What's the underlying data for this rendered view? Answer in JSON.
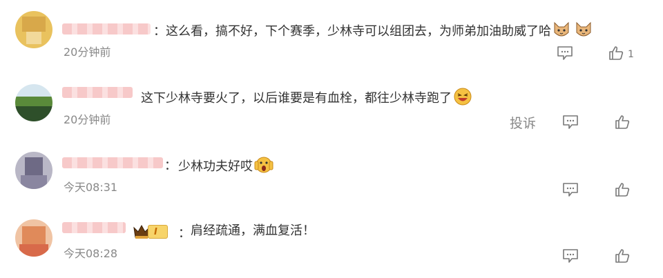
{
  "comments": [
    {
      "separator": "：",
      "text": "这么看，搞不好，下个赛季，少林寺可以组团去，为师弟加油助威了哈",
      "emojis": [
        "cat-face-emoji",
        "cat-face-emoji"
      ],
      "time": "20分钟前",
      "like_count": "1"
    },
    {
      "separator": "",
      "text": "这下少林寺要火了，以后谁要是有血栓，都往少林寺跑了",
      "emojis": [
        "laughing-face-emoji"
      ],
      "time": "20分钟前",
      "report_label": "投诉"
    },
    {
      "separator": "：",
      "text": "少林功夫好哎",
      "emojis": [
        "screaming-face-emoji"
      ],
      "time": "今天08:31"
    },
    {
      "separator": "：",
      "text": "肩经疏通，满血复活！",
      "badge_level": "I",
      "time": "今天08:28"
    }
  ],
  "icons": {
    "reply": "comment-icon",
    "like": "thumbs-up-icon",
    "badge": "crown-icon"
  },
  "colors": {
    "text": "#333333",
    "meta": "#888888",
    "badge": "#f7d46a"
  }
}
